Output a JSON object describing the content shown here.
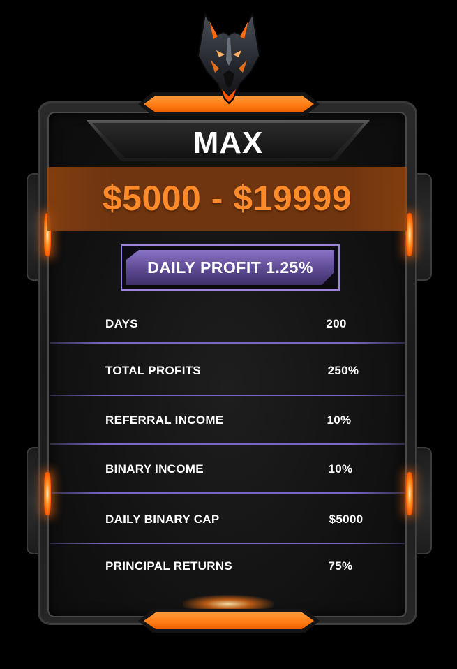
{
  "plan": {
    "title": "MAX",
    "price_range": "$5000 - $19999",
    "daily_profit_label": "DAILY PROFIT 1.25%"
  },
  "rows": [
    {
      "label": "DAYS",
      "value": "200"
    },
    {
      "label": "TOTAL PROFITS",
      "value": "250%"
    },
    {
      "label": "REFERRAL INCOME",
      "value": "10%"
    },
    {
      "label": "BINARY INCOME",
      "value": "10%"
    },
    {
      "label": "DAILY BINARY CAP",
      "value": "$5000"
    },
    {
      "label": "PRINCIPAL RETURNS",
      "value": "75%"
    }
  ],
  "colors": {
    "accent_orange": "#ff8a2a",
    "badge_purple": "#9d85d8",
    "background": "#000000"
  },
  "icons": {
    "emblem": "wolf-head-icon"
  }
}
